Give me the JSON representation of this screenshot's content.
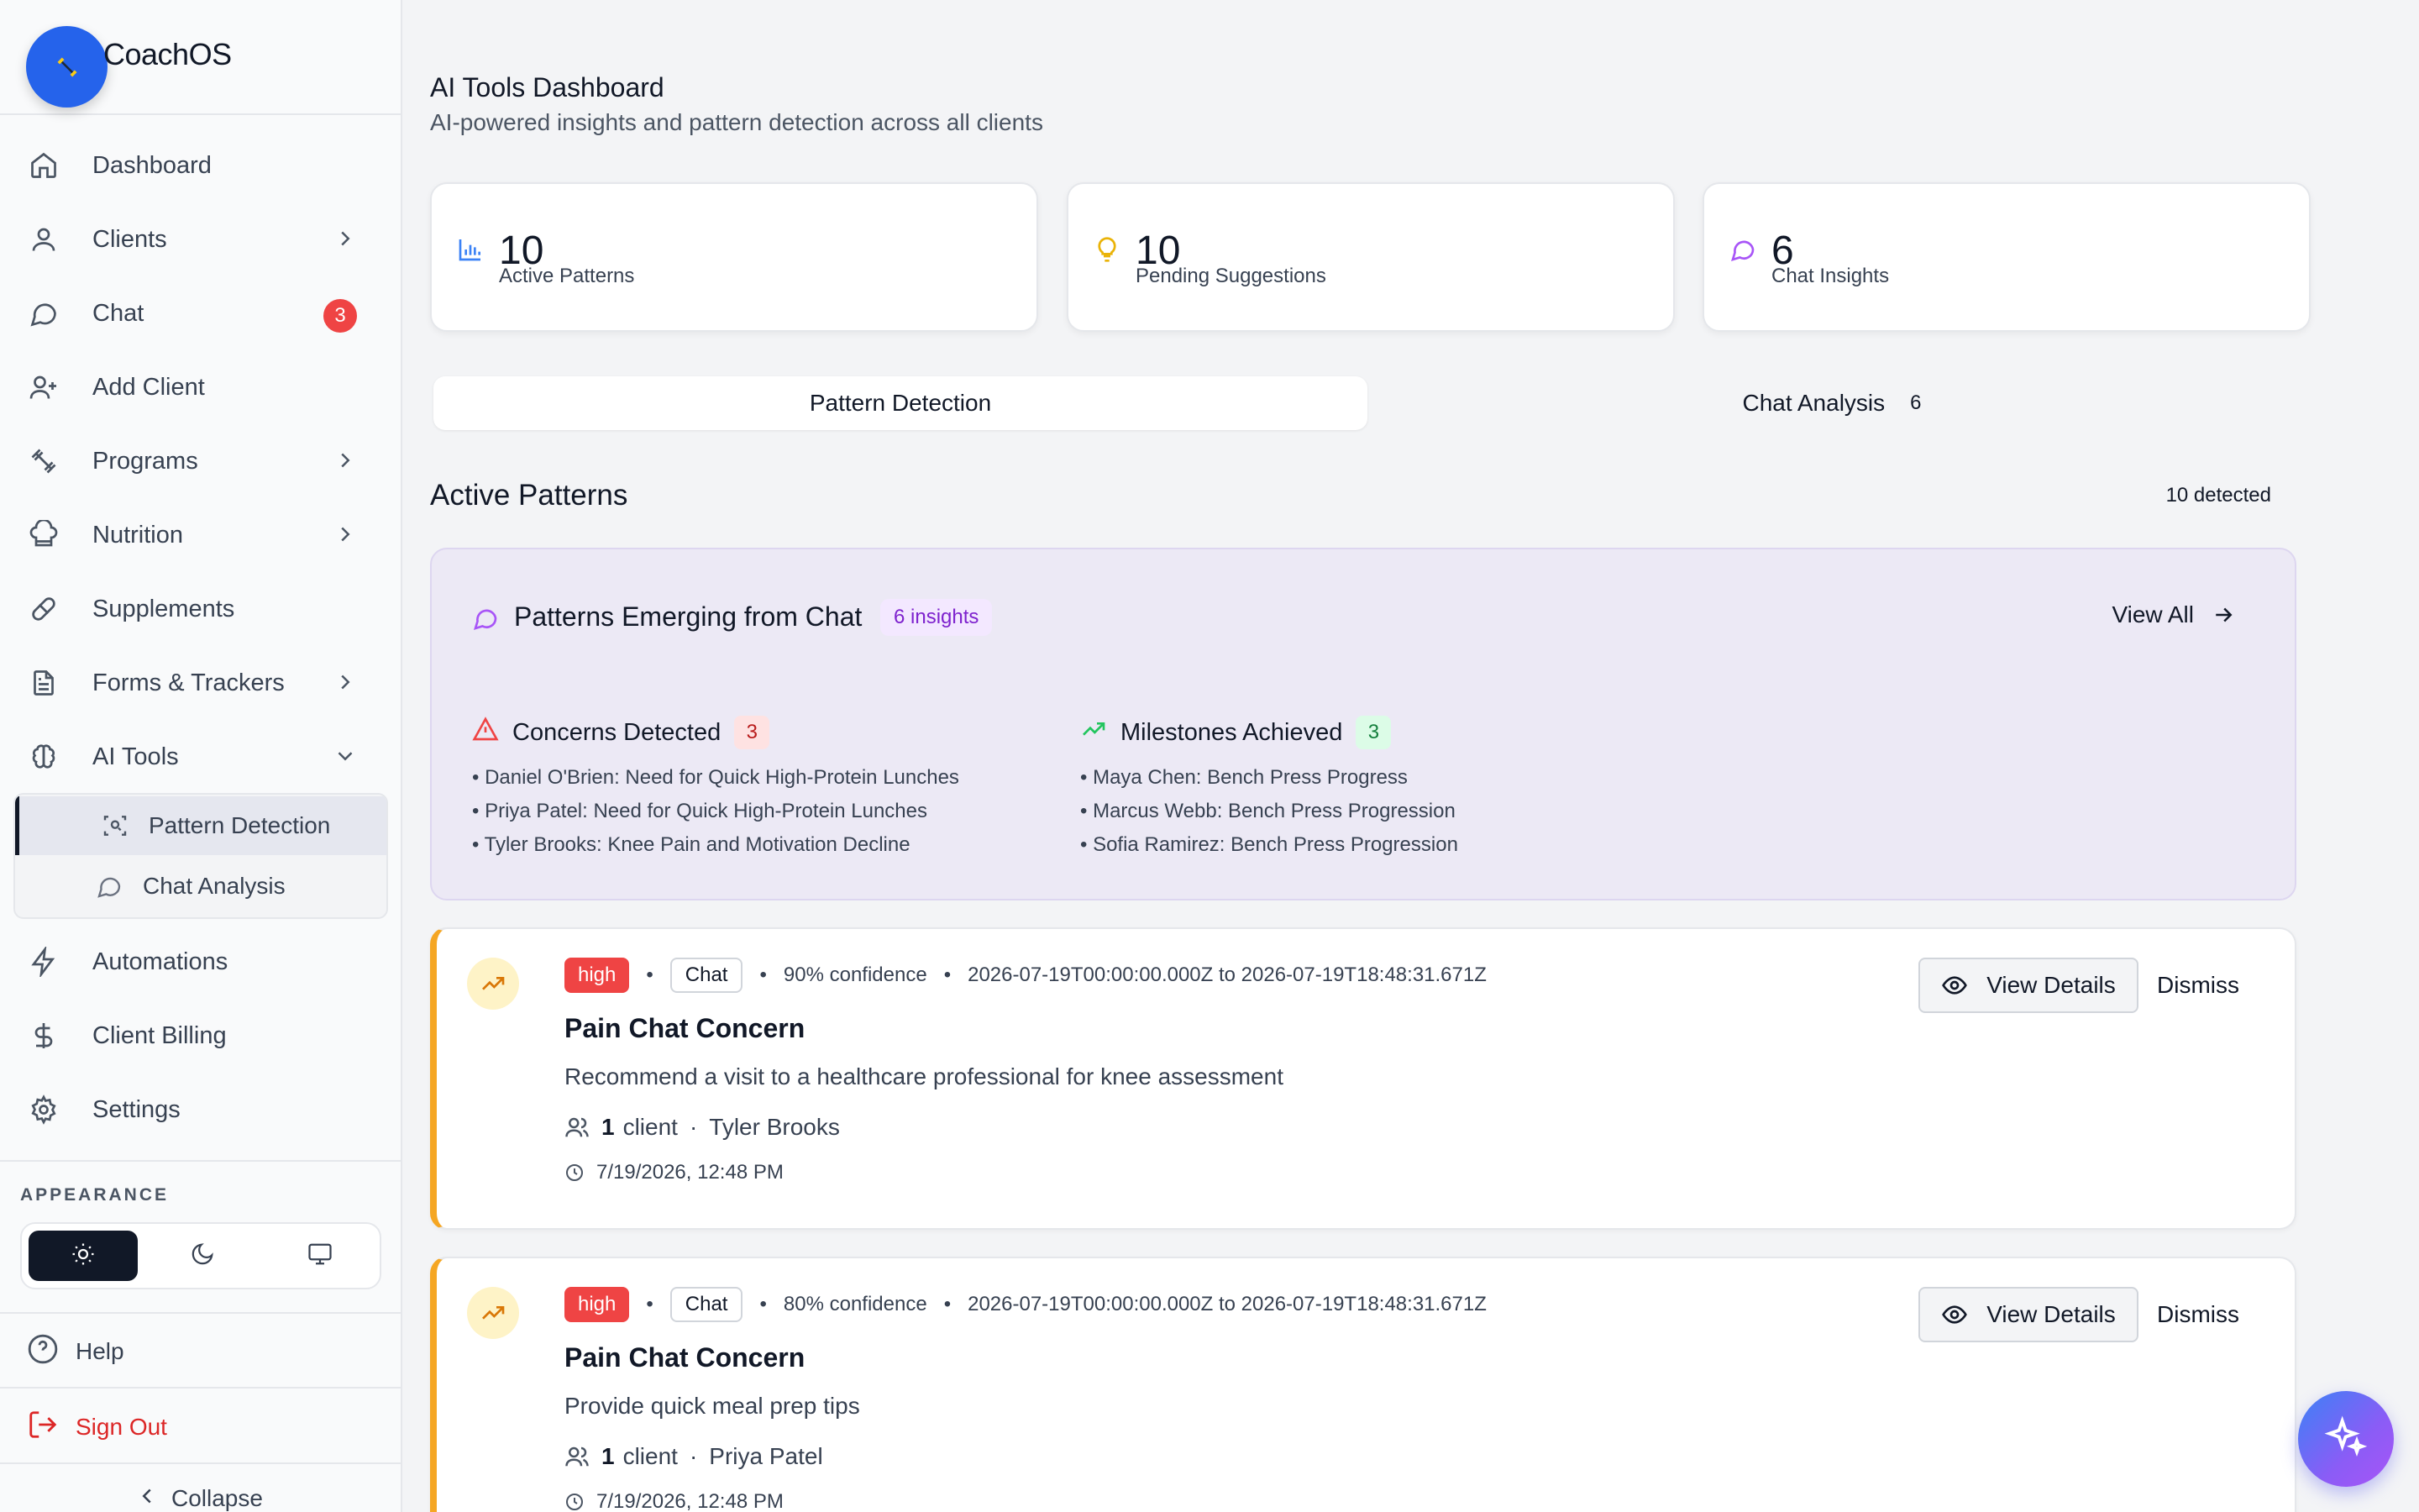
{
  "app": {
    "name": "CoachOS"
  },
  "sidebar": {
    "items": [
      {
        "label": "Dashboard"
      },
      {
        "label": "Clients"
      },
      {
        "label": "Chat",
        "badge": "3"
      },
      {
        "label": "Add Client"
      },
      {
        "label": "Programs"
      },
      {
        "label": "Nutrition"
      },
      {
        "label": "Supplements"
      },
      {
        "label": "Forms & Trackers"
      },
      {
        "label": "AI Tools"
      },
      {
        "label": "Automations"
      },
      {
        "label": "Client Billing"
      },
      {
        "label": "Settings"
      }
    ],
    "ai_tools_sub": [
      {
        "label": "Pattern Detection"
      },
      {
        "label": "Chat Analysis"
      }
    ],
    "appearance_label": "APPEARANCE",
    "help": "Help",
    "sign_out": "Sign Out",
    "collapse": "Collapse"
  },
  "main": {
    "title": "AI Tools Dashboard",
    "subtitle": "AI-powered insights and pattern detection across all clients",
    "stats": [
      {
        "value": "10",
        "label": "Active Patterns"
      },
      {
        "value": "10",
        "label": "Pending Suggestions"
      },
      {
        "value": "6",
        "label": "Chat Insights"
      }
    ],
    "tabs": [
      {
        "label": "Pattern Detection"
      },
      {
        "label": "Chat Analysis",
        "count": "6"
      }
    ],
    "section_title": "Active Patterns",
    "section_count": "10 detected",
    "emerging": {
      "title": "Patterns Emerging from Chat",
      "badge": "6 insights",
      "view_all": "View All",
      "concerns": {
        "title": "Concerns Detected",
        "count": "3",
        "items": [
          "Daniel O'Brien: Need for Quick High-Protein Lunches",
          "Priya Patel: Need for Quick High-Protein Lunches",
          "Tyler Brooks: Knee Pain and Motivation Decline"
        ]
      },
      "milestones": {
        "title": "Milestones Achieved",
        "count": "3",
        "items": [
          "Maya Chen: Bench Press Progress",
          "Marcus Webb: Bench Press Progression",
          "Sofia Ramirez: Bench Press Progression"
        ]
      }
    },
    "patterns": [
      {
        "severity": "high",
        "source": "Chat",
        "confidence": "90% confidence",
        "range": "2026-07-19T00:00:00.000Z to 2026-07-19T18:48:31.671Z",
        "title": "Pain Chat Concern",
        "description": "Recommend a visit to a healthcare professional for knee assessment",
        "client_count": "1",
        "client_word": "client",
        "client_name": "Tyler Brooks",
        "timestamp": "7/19/2026, 12:48 PM",
        "view_label": "View Details",
        "dismiss_label": "Dismiss"
      },
      {
        "severity": "high",
        "source": "Chat",
        "confidence": "80% confidence",
        "range": "2026-07-19T00:00:00.000Z to 2026-07-19T18:48:31.671Z",
        "title": "Pain Chat Concern",
        "description": "Provide quick meal prep tips",
        "client_count": "1",
        "client_word": "client",
        "client_name": "Priya Patel",
        "timestamp": "7/19/2026, 12:48 PM",
        "view_label": "View Details",
        "dismiss_label": "Dismiss"
      }
    ]
  },
  "colors": {
    "brand": "#2563eb",
    "high": "#ef4444",
    "accent_left_border": "#f5a623",
    "insight_purple": "#7e22ce"
  }
}
